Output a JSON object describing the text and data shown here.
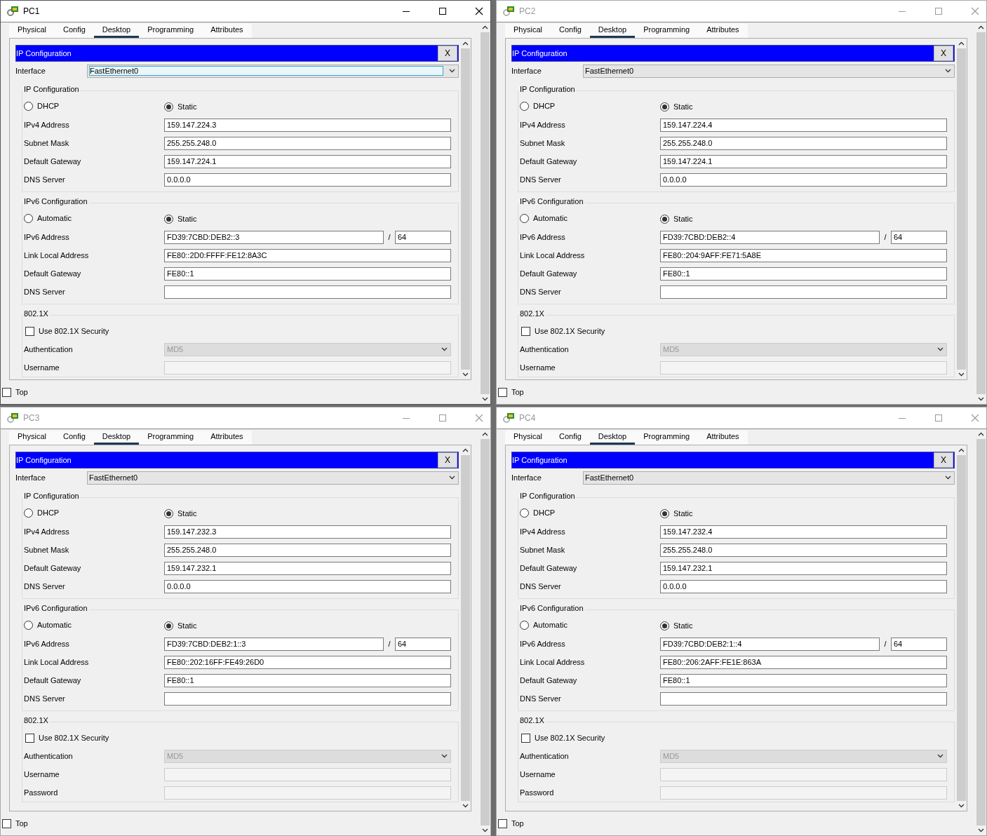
{
  "windows": [
    {
      "title": "PC1",
      "active": true,
      "tabs": [
        {
          "label": "Physical",
          "selected": false
        },
        {
          "label": "Config",
          "selected": false
        },
        {
          "label": "Desktop",
          "selected": true
        },
        {
          "label": "Programming",
          "selected": false
        },
        {
          "label": "Attributes",
          "selected": false
        }
      ],
      "panel": {
        "title": "IP Configuration",
        "close": "X",
        "interface": {
          "label": "Interface",
          "value": "FastEthernet0",
          "focused": true
        },
        "ipv4": {
          "legend": "IP Configuration",
          "modes": [
            {
              "label": "DHCP",
              "selected": false
            },
            {
              "label": "Static",
              "selected": true
            }
          ],
          "fields": [
            {
              "label": "IPv4 Address",
              "value": "159.147.224.3"
            },
            {
              "label": "Subnet Mask",
              "value": "255.255.248.0"
            },
            {
              "label": "Default Gateway",
              "value": "159.147.224.1"
            },
            {
              "label": "DNS Server",
              "value": "0.0.0.0"
            }
          ]
        },
        "ipv6": {
          "legend": "IPv6 Configuration",
          "modes": [
            {
              "label": "Automatic",
              "selected": false
            },
            {
              "label": "Static",
              "selected": true
            }
          ],
          "fields": [
            {
              "label": "IPv6 Address",
              "value": "FD39:7CBD:DEB2::3",
              "separator": "/",
              "prefix": "64"
            },
            {
              "label": "Link Local Address",
              "value": "FE80::2D0:FFFF:FE12:8A3C"
            },
            {
              "label": "Default Gateway",
              "value": "FE80::1"
            },
            {
              "label": "DNS Server"
            }
          ]
        },
        "dot1x": {
          "legend": "802.1X",
          "checkbox": {
            "label": "Use 802.1X Security",
            "checked": false
          },
          "fields": [
            {
              "kind": "select",
              "label": "Authentication",
              "value": "MD5",
              "disabled": true
            },
            {
              "kind": "text",
              "label": "Username",
              "disabled": true
            }
          ]
        }
      },
      "top": {
        "label": "Top",
        "checked": false
      }
    },
    {
      "title": "PC2",
      "active": false,
      "tabs": [
        {
          "label": "Physical",
          "selected": false
        },
        {
          "label": "Config",
          "selected": false
        },
        {
          "label": "Desktop",
          "selected": true
        },
        {
          "label": "Programming",
          "selected": false
        },
        {
          "label": "Attributes",
          "selected": false
        }
      ],
      "panel": {
        "title": "IP Configuration",
        "close": "X",
        "interface": {
          "label": "Interface",
          "value": "FastEthernet0",
          "focused": false
        },
        "ipv4": {
          "legend": "IP Configuration",
          "modes": [
            {
              "label": "DHCP",
              "selected": false
            },
            {
              "label": "Static",
              "selected": true
            }
          ],
          "fields": [
            {
              "label": "IPv4 Address",
              "value": "159.147.224.4"
            },
            {
              "label": "Subnet Mask",
              "value": "255.255.248.0"
            },
            {
              "label": "Default Gateway",
              "value": "159.147.224.1"
            },
            {
              "label": "DNS Server",
              "value": "0.0.0.0"
            }
          ]
        },
        "ipv6": {
          "legend": "IPv6 Configuration",
          "modes": [
            {
              "label": "Automatic",
              "selected": false
            },
            {
              "label": "Static",
              "selected": true
            }
          ],
          "fields": [
            {
              "label": "IPv6 Address",
              "value": "FD39:7CBD:DEB2::4",
              "separator": "/",
              "prefix": "64"
            },
            {
              "label": "Link Local Address",
              "value": "FE80::204:9AFF:FE71:5A8E"
            },
            {
              "label": "Default Gateway",
              "value": "FE80::1"
            },
            {
              "label": "DNS Server"
            }
          ]
        },
        "dot1x": {
          "legend": "802.1X",
          "checkbox": {
            "label": "Use 802.1X Security",
            "checked": false
          },
          "fields": [
            {
              "kind": "select",
              "label": "Authentication",
              "value": "MD5",
              "disabled": true
            },
            {
              "kind": "text",
              "label": "Username",
              "disabled": true
            }
          ]
        }
      },
      "top": {
        "label": "Top",
        "checked": false
      }
    },
    {
      "title": "PC3",
      "active": false,
      "tabs": [
        {
          "label": "Physical",
          "selected": false
        },
        {
          "label": "Config",
          "selected": false
        },
        {
          "label": "Desktop",
          "selected": true
        },
        {
          "label": "Programming",
          "selected": false
        },
        {
          "label": "Attributes",
          "selected": false
        }
      ],
      "panel": {
        "title": "IP Configuration",
        "close": "X",
        "interface": {
          "label": "Interface",
          "value": "FastEthernet0",
          "focused": false
        },
        "ipv4": {
          "legend": "IP Configuration",
          "modes": [
            {
              "label": "DHCP",
              "selected": false
            },
            {
              "label": "Static",
              "selected": true
            }
          ],
          "fields": [
            {
              "label": "IPv4 Address",
              "value": "159.147.232.3"
            },
            {
              "label": "Subnet Mask",
              "value": "255.255.248.0"
            },
            {
              "label": "Default Gateway",
              "value": "159.147.232.1"
            },
            {
              "label": "DNS Server",
              "value": "0.0.0.0"
            }
          ]
        },
        "ipv6": {
          "legend": "IPv6 Configuration",
          "modes": [
            {
              "label": "Automatic",
              "selected": false
            },
            {
              "label": "Static",
              "selected": true
            }
          ],
          "fields": [
            {
              "label": "IPv6 Address",
              "value": "FD39:7CBD:DEB2:1::3",
              "separator": "/",
              "prefix": "64"
            },
            {
              "label": "Link Local Address",
              "value": "FE80::202:16FF:FE49:26D0"
            },
            {
              "label": "Default Gateway",
              "value": "FE80::1"
            },
            {
              "label": "DNS Server"
            }
          ]
        },
        "dot1x": {
          "legend": "802.1X",
          "checkbox": {
            "label": "Use 802.1X Security",
            "checked": false
          },
          "fields": [
            {
              "kind": "select",
              "label": "Authentication",
              "value": "MD5",
              "disabled": true
            },
            {
              "kind": "text",
              "label": "Username",
              "disabled": true
            },
            {
              "kind": "text",
              "label": "Password",
              "disabled": true
            }
          ]
        }
      },
      "top": {
        "label": "Top",
        "checked": false
      }
    },
    {
      "title": "PC4",
      "active": false,
      "tabs": [
        {
          "label": "Physical",
          "selected": false
        },
        {
          "label": "Config",
          "selected": false
        },
        {
          "label": "Desktop",
          "selected": true
        },
        {
          "label": "Programming",
          "selected": false
        },
        {
          "label": "Attributes",
          "selected": false
        }
      ],
      "panel": {
        "title": "IP Configuration",
        "close": "X",
        "interface": {
          "label": "Interface",
          "value": "FastEthernet0",
          "focused": false
        },
        "ipv4": {
          "legend": "IP Configuration",
          "modes": [
            {
              "label": "DHCP",
              "selected": false
            },
            {
              "label": "Static",
              "selected": true
            }
          ],
          "fields": [
            {
              "label": "IPv4 Address",
              "value": "159.147.232.4"
            },
            {
              "label": "Subnet Mask",
              "value": "255.255.248.0"
            },
            {
              "label": "Default Gateway",
              "value": "159.147.232.1"
            },
            {
              "label": "DNS Server",
              "value": "0.0.0.0"
            }
          ]
        },
        "ipv6": {
          "legend": "IPv6 Configuration",
          "modes": [
            {
              "label": "Automatic",
              "selected": false
            },
            {
              "label": "Static",
              "selected": true
            }
          ],
          "fields": [
            {
              "label": "IPv6 Address",
              "value": "FD39:7CBD:DEB2:1::4",
              "separator": "/",
              "prefix": "64"
            },
            {
              "label": "Link Local Address",
              "value": "FE80::206:2AFF:FE1E:863A"
            },
            {
              "label": "Default Gateway",
              "value": "FE80::1"
            },
            {
              "label": "DNS Server"
            }
          ]
        },
        "dot1x": {
          "legend": "802.1X",
          "checkbox": {
            "label": "Use 802.1X Security",
            "checked": false
          },
          "fields": [
            {
              "kind": "select",
              "label": "Authentication",
              "value": "MD5",
              "disabled": true
            },
            {
              "kind": "text",
              "label": "Username",
              "disabled": true
            },
            {
              "kind": "text",
              "label": "Password",
              "disabled": true
            }
          ]
        }
      },
      "top": {
        "label": "Top",
        "checked": false
      }
    }
  ]
}
